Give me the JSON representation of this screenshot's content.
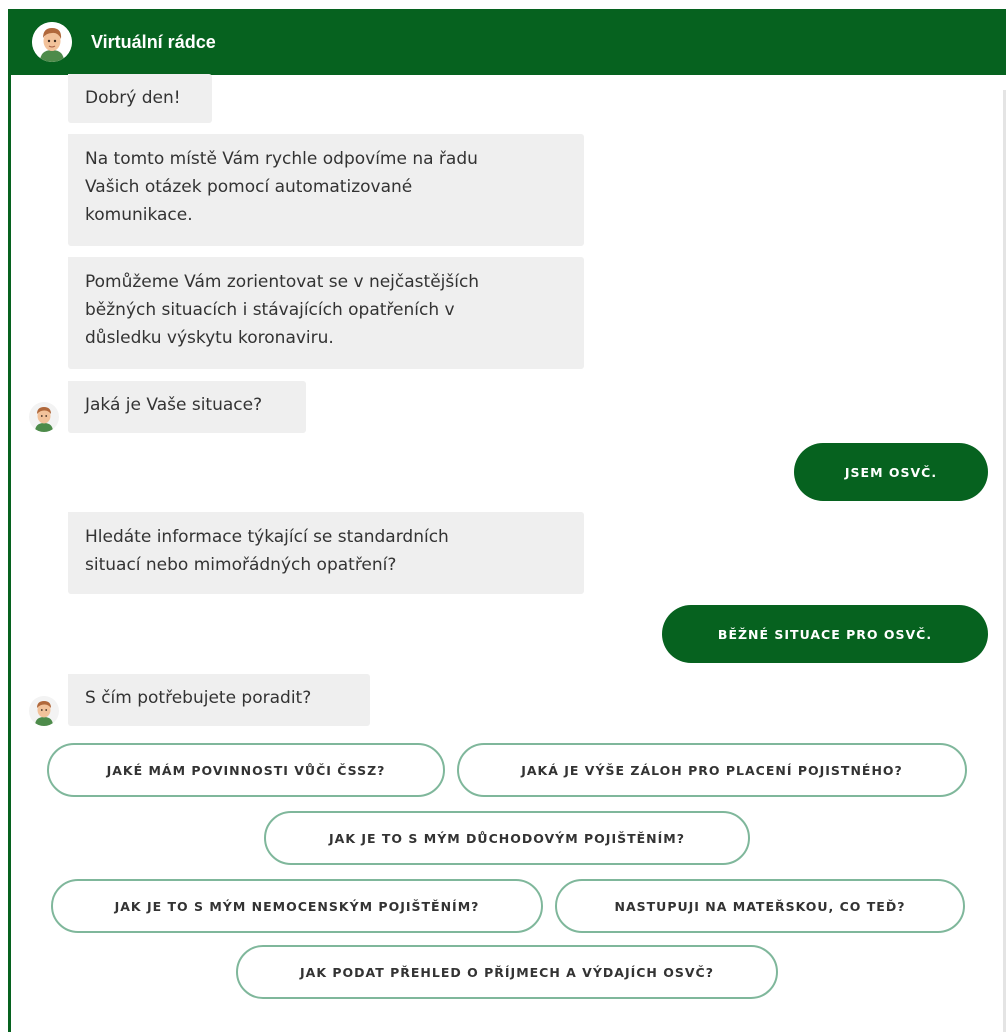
{
  "header": {
    "title": "Virtuální rádce",
    "avatar_icon": "advisor-avatar-icon"
  },
  "messages": {
    "greeting": "Dobrý den!",
    "intro": "Na tomto místě Vám rychle odpovíme na řadu\nVašich otázek pomocí automatizované\nkomunikace.",
    "help": "Pomůžeme Vám zorientovat se v nejčastějších\nběžných situacích i stávajících opatřeních v\ndůsledku výskytu koronaviru.",
    "question_situation": "Jaká je Vaše situace?",
    "user_reply_1": "JSEM OSVČ.",
    "question_info": "Hledáte informace týkající se standardních\nsituací nebo mimořádných opatření?",
    "user_reply_2": "BĚŽNÉ SITUACE PRO OSVČ.",
    "question_help": "S čím potřebujete poradit?"
  },
  "quick_replies": [
    "JAKÉ MÁM POVINNOSTI VŮČI ČSSZ?",
    "JAKÁ JE VÝŠE ZÁLOH PRO PLACENÍ POJISTNÉHO?",
    "JAK JE TO S MÝM DŮCHODOVÝM POJIŠTĚNÍM?",
    "JAK JE TO S MÝM NEMOCENSKÝM POJIŠTĚNÍM?",
    "NASTUPUJI NA MATEŘSKOU, CO TEĎ?",
    "JAK PODAT PŘEHLED O PŘÍJMECH A VÝDAJÍCH OSVČ?"
  ],
  "colors": {
    "brand_green": "#06621f",
    "bubble_gray": "#efefef",
    "quick_reply_border": "#7fb79b"
  }
}
